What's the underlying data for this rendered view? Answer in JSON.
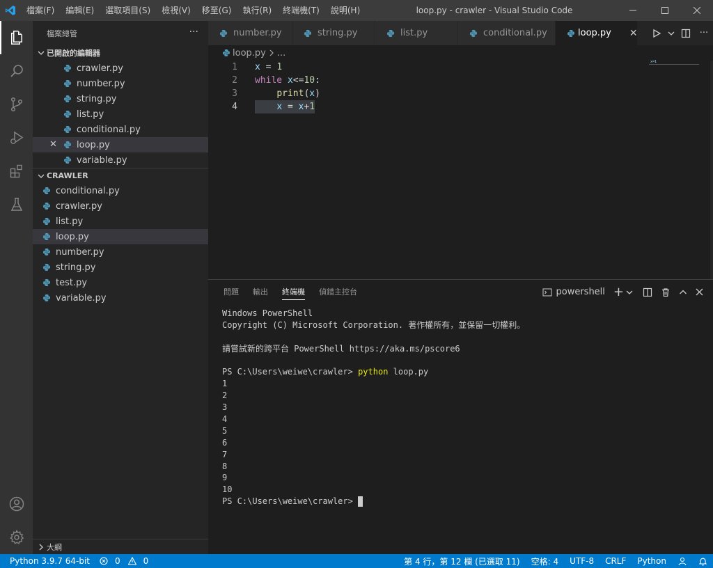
{
  "titlebar": {
    "menu": [
      "檔案(F)",
      "編輯(E)",
      "選取項目(S)",
      "檢視(V)",
      "移至(G)",
      "執行(R)",
      "終端機(T)",
      "說明(H)"
    ],
    "title": "loop.py - crawler - Visual Studio Code"
  },
  "sidebar": {
    "header": "檔案總管",
    "open_editors_title": "已開啟的編輯器",
    "open_editors": [
      "crawler.py",
      "number.py",
      "string.py",
      "list.py",
      "conditional.py",
      "loop.py",
      "variable.py"
    ],
    "folder_title": "CRAWLER",
    "files": [
      "conditional.py",
      "crawler.py",
      "list.py",
      "loop.py",
      "number.py",
      "string.py",
      "test.py",
      "variable.py"
    ],
    "outline_title": "大綱"
  },
  "tabs": [
    "number.py",
    "string.py",
    "list.py",
    "conditional.py",
    "loop.py"
  ],
  "breadcrumb": {
    "file": "loop.py",
    "rest": "..."
  },
  "code": {
    "line_numbers": [
      "1",
      "2",
      "3",
      "4"
    ],
    "l1": {
      "a": "x",
      "b": " = ",
      "c": "1"
    },
    "l2": {
      "a": "while",
      "b": " x",
      "c": "<=",
      "d": "10",
      "e": ":"
    },
    "l3": {
      "a": "    ",
      "b": "print",
      "c": "(",
      "d": "x",
      "e": ")"
    },
    "l4": {
      "a": "x",
      "b": " = ",
      "c": "x",
      "d": "+",
      "e": "1"
    },
    "minimap_text": "x=1"
  },
  "panel": {
    "tabs": [
      "問題",
      "輸出",
      "終端機",
      "偵錯主控台"
    ],
    "shell_name": "powershell",
    "terminal": {
      "l1": "Windows PowerShell",
      "l2": "Copyright (C) Microsoft Corporation. 著作權所有，並保留一切權利。",
      "l3": "請嘗試新的跨平台 PowerShell https://aka.ms/pscore6",
      "prompt": "PS C:\\Users\\weiwe\\crawler> ",
      "cmd_name": "python",
      "cmd_args": " loop.py",
      "outputs": [
        "1",
        "2",
        "3",
        "4",
        "5",
        "6",
        "7",
        "8",
        "9",
        "10"
      ]
    }
  },
  "statusbar": {
    "python": "Python 3.9.7 64-bit",
    "errors": "0",
    "warnings": "0",
    "position": "第 4 行，第 12 欄 (已選取 11)",
    "spaces": "空格: 4",
    "encoding": "UTF-8",
    "eol": "CRLF",
    "language": "Python"
  },
  "colors": {
    "accent": "#007acc",
    "python_icon": "#519aba"
  }
}
